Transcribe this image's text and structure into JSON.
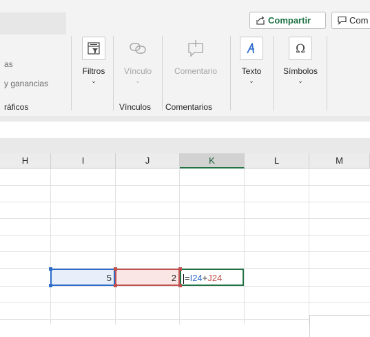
{
  "ribbon": {
    "share_label": "Compartir",
    "comments_label": "Com",
    "left_partial": {
      "line1": "as",
      "line2": "y ganancias",
      "group": "ráficos"
    },
    "buttons": [
      {
        "id": "filtros",
        "label": "Filtros",
        "icon": "filter-icon",
        "chevron": "⌄",
        "enabled": true
      },
      {
        "id": "vinculo",
        "label": "Vínculo",
        "icon": "link-icon",
        "chevron": "⌄",
        "enabled": false
      },
      {
        "id": "comentario",
        "label": "Comentario",
        "icon": "comment-icon",
        "enabled": false
      },
      {
        "id": "texto",
        "label": "Texto",
        "icon": "text-icon",
        "chevron": "⌄",
        "enabled": true
      },
      {
        "id": "simbolos",
        "label": "Símbolos",
        "icon": "omega-icon",
        "chevron": "⌄",
        "enabled": true
      }
    ],
    "groups": {
      "vinculos": "Vínculos",
      "comentarios": "Comentarios"
    }
  },
  "sheet": {
    "columns": [
      "H",
      "I",
      "J",
      "K",
      "L",
      "M"
    ],
    "active_column": "K",
    "cells": {
      "I24": "5",
      "J24": "2",
      "K24": {
        "prefix": "=",
        "ref1": "I24",
        "op": "+",
        "ref2": "J24"
      }
    }
  },
  "colors": {
    "excel_green": "#217346",
    "ref_blue": "#2e6cc9",
    "ref_red": "#c0504d"
  }
}
